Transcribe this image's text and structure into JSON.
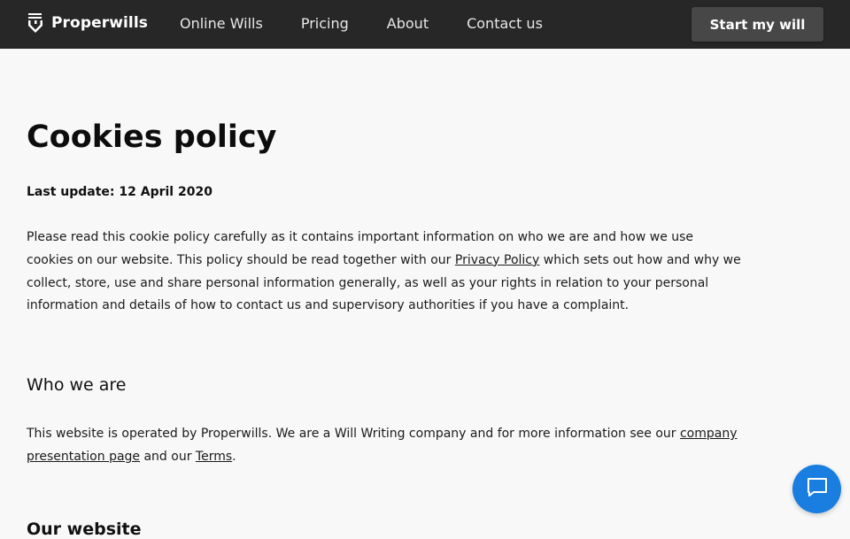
{
  "header": {
    "brand": "Properwills",
    "nav": [
      "Online Wills",
      "Pricing",
      "About",
      "Contact us"
    ],
    "cta": "Start my will"
  },
  "main": {
    "title": "Cookies policy",
    "last_update": "Last update: 12 April 2020",
    "intro": {
      "before_link": "Please read this cookie policy carefully as it contains important information on who we are and how we use cookies on our website. This policy should be read together with our ",
      "link": "Privacy Policy",
      "after_link": " which sets out how and why we collect, store, use and share personal information generally, as well as your rights in relation to your personal information and details of how to contact us and supervisory authorities if you have a complaint."
    },
    "who_we_are": {
      "heading": "Who we are",
      "before_link1": "This website is operated by Properwills. We are a Will Writing company and for more information see our ",
      "link1": "company presentation page",
      "between_links": " and our ",
      "link2": "Terms",
      "after_link2": "."
    },
    "next_heading": "Our website"
  },
  "chat": {
    "icon": "chat-bubble-icon",
    "color": "#1a7ee0"
  },
  "colors": {
    "header_bg": "#272727",
    "cta_bg": "#474747",
    "page_bg": "#f8f8f9"
  }
}
